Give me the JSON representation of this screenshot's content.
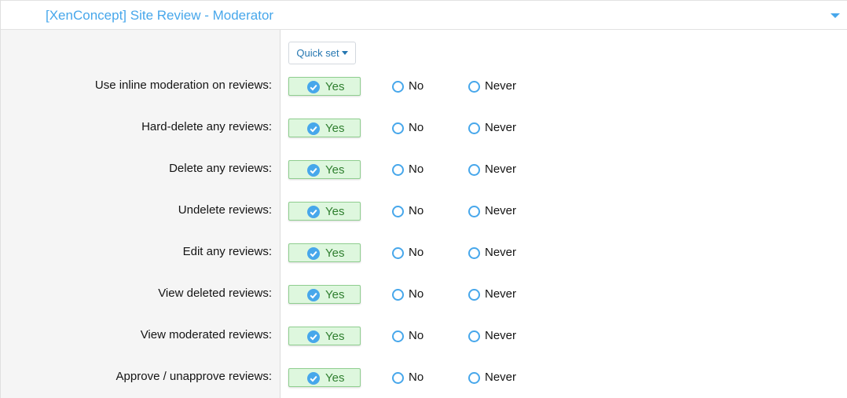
{
  "section": {
    "title": "[XenConcept] Site Review - Moderator",
    "toggle_icon": "chevron-down-icon"
  },
  "quick_set": {
    "label": "Quick set"
  },
  "colors": {
    "accent": "#47a7eb",
    "selected_bg": "#def7de",
    "selected_border": "#8fce8f",
    "selected_text": "#2f7f2f"
  },
  "options": {
    "yes": "Yes",
    "no": "No",
    "never": "Never"
  },
  "permissions": [
    {
      "label": "Use inline moderation on reviews:",
      "selected": "yes"
    },
    {
      "label": "Hard-delete any reviews:",
      "selected": "yes"
    },
    {
      "label": "Delete any reviews:",
      "selected": "yes"
    },
    {
      "label": "Undelete reviews:",
      "selected": "yes"
    },
    {
      "label": "Edit any reviews:",
      "selected": "yes"
    },
    {
      "label": "View deleted reviews:",
      "selected": "yes"
    },
    {
      "label": "View moderated reviews:",
      "selected": "yes"
    },
    {
      "label": "Approve / unapprove reviews:",
      "selected": "yes"
    }
  ]
}
